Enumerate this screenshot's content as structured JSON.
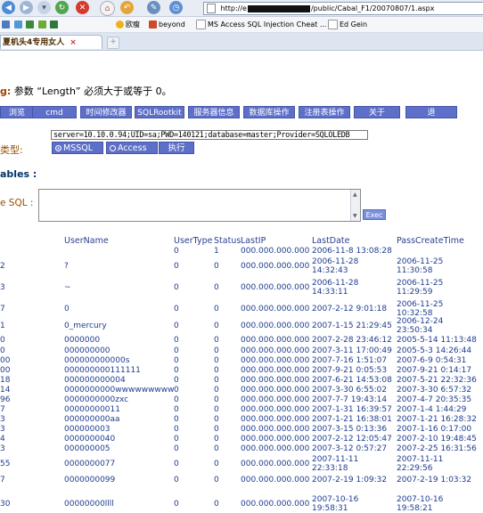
{
  "browser": {
    "address_prefix": "http://e",
    "address_suffix": "/public/Cabal_F1/20070807/1.aspx",
    "bookmarks": [
      "欧瘦",
      "beyond",
      "MS Access SQL Injection Cheat ...",
      "Ed Gein"
    ],
    "tab_title": "夏机头4专用女人",
    "tab_close": "×"
  },
  "page": {
    "error_label": "g:",
    "error_text": " 参数 “Length” 必须大于或等于 0。",
    "toolbar": [
      "浏览",
      "cmd",
      "时间修改器",
      "SQLRootkit",
      "服务器信息",
      "数据库操作",
      "注册表操作",
      "关于",
      "退"
    ],
    "connection_string": "server=10.10.0.94;UID=sa;PWD=140121;database=master;Provider=SQLOLEDB",
    "type_label": "类型:",
    "radio_mssql": "MSSQL",
    "radio_access": "Access",
    "exec_button": "执行",
    "tables_heading": "ables :",
    "sql_label": "e SQL :",
    "exec2_button": "Exec"
  },
  "table": {
    "headers": [
      "UserName",
      "UserType",
      "Status",
      "LastIP",
      "LastDate",
      "PassCreateTime"
    ],
    "rows": [
      {
        "id": "",
        "user": "",
        "type": "0",
        "status": "1",
        "ip": "000.000.000.000",
        "last": "2006-11-8 13:08:28",
        "pass": ""
      },
      {
        "id": "2",
        "user": "?",
        "type": "0",
        "status": "0",
        "ip": "000.000.000.000",
        "last": "2006-11-28\n14:32:43",
        "pass": "2006-11-25\n11:30:58"
      },
      {
        "id": "3",
        "user": "~",
        "type": "0",
        "status": "0",
        "ip": "000.000.000.000",
        "last": "2006-11-28\n14:33:11",
        "pass": "2006-11-25\n11:29:59"
      },
      {
        "id": "7",
        "user": "0",
        "type": "0",
        "status": "0",
        "ip": "000.000.000.000",
        "last": "2007-2-12 9:01:18",
        "pass": "2006-11-25\n10:32:58"
      },
      {
        "id": "1",
        "user": "0_mercury",
        "type": "0",
        "status": "0",
        "ip": "000.000.000.000",
        "last": "2007-1-15 21:29:45",
        "pass": "2006-12-24\n23:50:34"
      },
      {
        "id": "0",
        "user": "0000000",
        "type": "0",
        "status": "0",
        "ip": "000.000.000.000",
        "last": "2007-2-28 23:46:12",
        "pass": "2005-5-14 11:13:48"
      },
      {
        "id": "0",
        "user": "000000000",
        "type": "0",
        "status": "0",
        "ip": "000.000.000.000",
        "last": "2007-3-11 17:00:49",
        "pass": "2005-5-3 14:26:44"
      },
      {
        "id": "00",
        "user": "000000000000s",
        "type": "0",
        "status": "0",
        "ip": "000.000.000.000",
        "last": "2007-7-16 1:51:07",
        "pass": "2007-6-9 0:54:31"
      },
      {
        "id": "00",
        "user": "000000000111111",
        "type": "0",
        "status": "0",
        "ip": "000.000.000.000",
        "last": "2007-9-21 0:05:53",
        "pass": "2007-9-21 0:14:17"
      },
      {
        "id": "18",
        "user": "000000000004",
        "type": "0",
        "status": "0",
        "ip": "000.000.000.000",
        "last": "2007-6-21 14:53:08",
        "pass": "2007-5-21 22:32:36"
      },
      {
        "id": "14",
        "user": "0000000000wwwwwwwww",
        "type": "0",
        "status": "0",
        "ip": "000.000.000.000",
        "last": "2007-3-30 6:55:02",
        "pass": "2007-3-30 6:57:32"
      },
      {
        "id": "96",
        "user": "0000000000zxc",
        "type": "0",
        "status": "0",
        "ip": "000.000.000.000",
        "last": "2007-7-7 19:43:14",
        "pass": "2007-4-7 20:35:35"
      },
      {
        "id": "7",
        "user": "00000000011",
        "type": "0",
        "status": "0",
        "ip": "000.000.000.000",
        "last": "2007-1-31 16:39:57",
        "pass": "2007-1-4 1:44:29"
      },
      {
        "id": "3",
        "user": "000000000aa",
        "type": "0",
        "status": "0",
        "ip": "000.000.000.000",
        "last": "2007-1-21 16:38:01",
        "pass": "2007-1-21 16:28:32"
      },
      {
        "id": "3",
        "user": "000000003",
        "type": "0",
        "status": "0",
        "ip": "000.000.000.000",
        "last": "2007-3-15 0:13:36",
        "pass": "2007-1-16 0:17:00"
      },
      {
        "id": "4",
        "user": "0000000040",
        "type": "0",
        "status": "0",
        "ip": "000.000.000.000",
        "last": "2007-2-12 12:05:47",
        "pass": "2007-2-10 19:48:45"
      },
      {
        "id": "3",
        "user": "000000005",
        "type": "0",
        "status": "0",
        "ip": "000.000.000.000",
        "last": "2007-3-12 0:57:27",
        "pass": "2007-2-25 16:31:56"
      },
      {
        "id": "55",
        "user": "0000000077",
        "type": "0",
        "status": "0",
        "ip": "000.000.000.000",
        "last": "2007-11-11\n22:33:18",
        "pass": "2007-11-11\n22:29:56"
      },
      {
        "id": "7",
        "user": "0000000099",
        "type": "0",
        "status": "0",
        "ip": "000.000.000.000",
        "last": "2007-2-19 1:09:32",
        "pass": "2007-2-19 1:03:32"
      },
      {
        "id": "30",
        "user": "00000000llll",
        "type": "0",
        "status": "0",
        "ip": "000.000.000.000",
        "last": "2007-10-16\n19:58:31",
        "pass": "2007-10-16\n19:58:21"
      }
    ]
  }
}
